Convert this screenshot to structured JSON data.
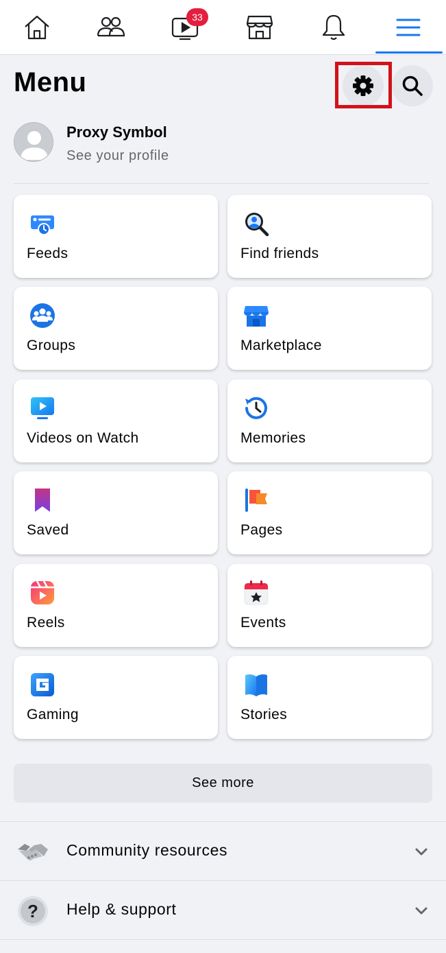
{
  "nav": {
    "items": [
      {
        "name": "home-icon"
      },
      {
        "name": "friends-icon"
      },
      {
        "name": "watch-icon",
        "badge": "33"
      },
      {
        "name": "marketplace-icon"
      },
      {
        "name": "notifications-icon"
      },
      {
        "name": "menu-icon",
        "active": true
      }
    ],
    "active_color": "#1877f2",
    "badge_color": "#e41e3f"
  },
  "header": {
    "title": "Menu",
    "settings_icon": "gear-icon",
    "search_icon": "search-icon"
  },
  "profile": {
    "name": "Proxy Symbol",
    "subtitle": "See your profile"
  },
  "shortcuts": [
    {
      "label": "Feeds",
      "icon": "feeds-icon"
    },
    {
      "label": "Find friends",
      "icon": "find-friends-icon"
    },
    {
      "label": "Groups",
      "icon": "groups-icon"
    },
    {
      "label": "Marketplace",
      "icon": "marketplace-icon"
    },
    {
      "label": "Videos on Watch",
      "icon": "video-icon"
    },
    {
      "label": "Memories",
      "icon": "memories-icon"
    },
    {
      "label": "Saved",
      "icon": "saved-icon"
    },
    {
      "label": "Pages",
      "icon": "pages-icon"
    },
    {
      "label": "Reels",
      "icon": "reels-icon"
    },
    {
      "label": "Events",
      "icon": "events-icon"
    },
    {
      "label": "Gaming",
      "icon": "gaming-icon"
    },
    {
      "label": "Stories",
      "icon": "stories-icon"
    }
  ],
  "see_more": "See more",
  "sections": [
    {
      "label": "Community resources",
      "icon": "handshake-icon"
    },
    {
      "label": "Help & support",
      "icon": "help-icon"
    }
  ],
  "highlight_color": "#d2121b"
}
